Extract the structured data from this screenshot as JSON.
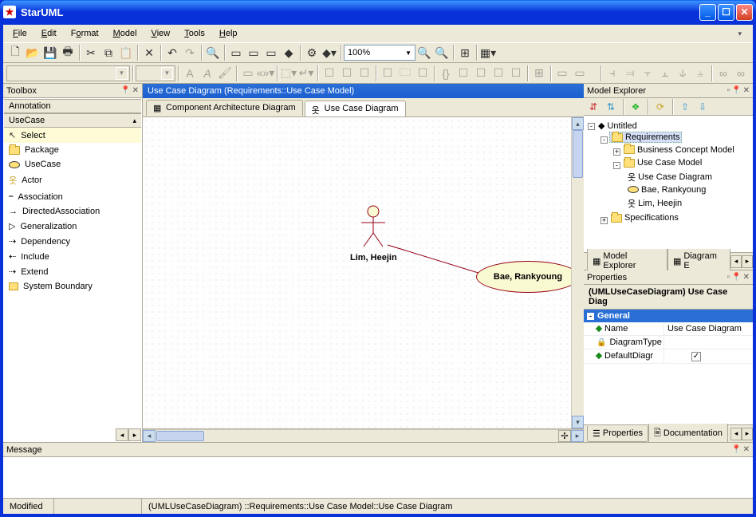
{
  "window": {
    "title": "StarUML"
  },
  "menu": {
    "file": "File",
    "edit": "Edit",
    "format": "Format",
    "model": "Model",
    "view": "View",
    "tools": "Tools",
    "help": "Help"
  },
  "zoom": {
    "value": "100%"
  },
  "toolbox": {
    "title": "Toolbox",
    "groups": {
      "annotation": "Annotation",
      "usecase": "UseCase"
    },
    "items": [
      {
        "label": "Select"
      },
      {
        "label": "Package"
      },
      {
        "label": "UseCase"
      },
      {
        "label": "Actor"
      },
      {
        "label": "Association"
      },
      {
        "label": "DirectedAssociation"
      },
      {
        "label": "Generalization"
      },
      {
        "label": "Dependency"
      },
      {
        "label": "Include"
      },
      {
        "label": "Extend"
      },
      {
        "label": "System Boundary"
      }
    ]
  },
  "canvas": {
    "title": "Use Case Diagram (Requirements::Use Case Model)",
    "tabs": {
      "component": "Component Architecture Diagram",
      "usecase": "Use Case Diagram"
    },
    "actor_label": "Lim, Heejin",
    "usecase_label": "Bae, Rankyoung"
  },
  "model_explorer": {
    "title": "Model Explorer",
    "tabs": {
      "explorer": "Model Explorer",
      "diagram": "Diagram E"
    },
    "root": "Untitled",
    "nodes": {
      "requirements": "Requirements",
      "bcm": "Business Concept Model",
      "ucm": "Use Case Model",
      "ucd": "Use Case Diagram",
      "bae": "Bae, Rankyoung",
      "lim": "Lim, Heejin",
      "spec": "Specifications"
    }
  },
  "properties": {
    "title": "Properties",
    "object": "(UMLUseCaseDiagram) Use Case Diag",
    "category": "General",
    "rows": {
      "name_label": "Name",
      "name_value": "Use Case Diagram",
      "type_label": "DiagramType",
      "type_value": "",
      "default_label": "DefaultDiagr",
      "default_checked": "✓"
    },
    "tabs": {
      "properties": "Properties",
      "documentation": "Documentation"
    }
  },
  "message": {
    "title": "Message"
  },
  "status": {
    "modified": "Modified",
    "path": "(UMLUseCaseDiagram) ::Requirements::Use Case Model::Use Case Diagram"
  }
}
